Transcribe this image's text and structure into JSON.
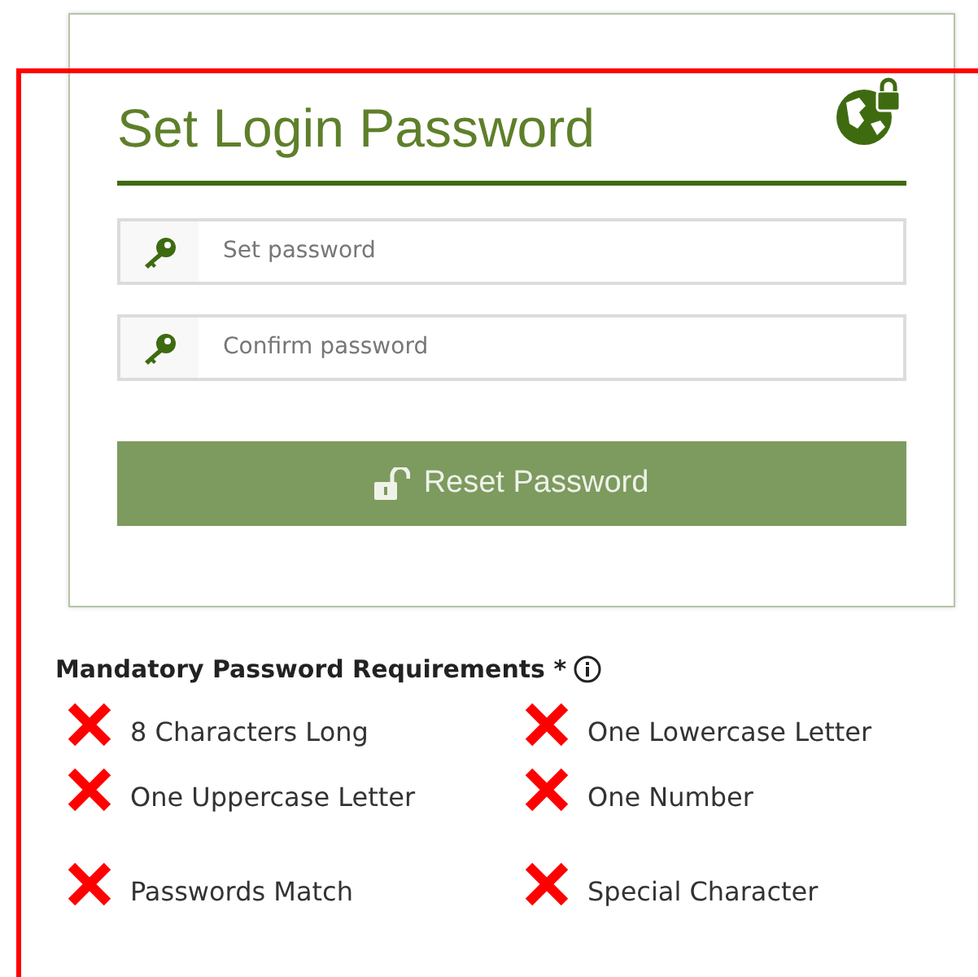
{
  "card": {
    "title": "Set Login Password",
    "fields": [
      {
        "placeholder": "Set password"
      },
      {
        "placeholder": "Confirm password"
      }
    ],
    "button": "Reset Password"
  },
  "requirements": {
    "heading": "Mandatory Password Requirements *",
    "items": [
      {
        "label": "8 Characters Long",
        "met": false
      },
      {
        "label": "One Lowercase Letter",
        "met": false
      },
      {
        "label": "One Uppercase Letter",
        "met": false
      },
      {
        "label": "One Number",
        "met": false
      },
      {
        "label": "Passwords Match",
        "met": false
      },
      {
        "label": "Special Character",
        "met": false
      }
    ]
  }
}
